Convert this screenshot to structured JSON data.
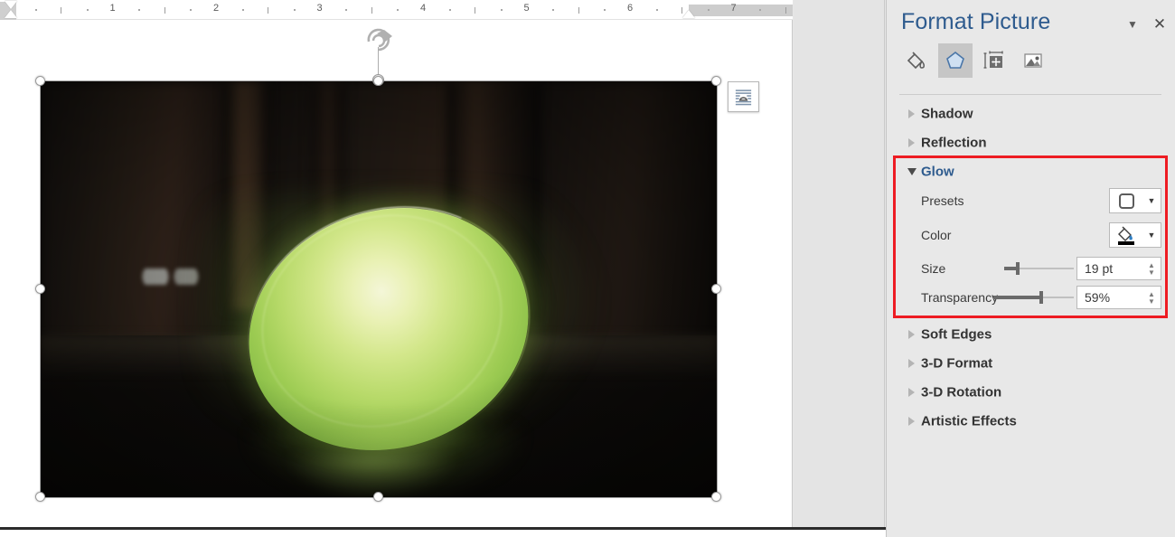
{
  "panel": {
    "title": "Format Picture",
    "caret_icon": "chevron-down-icon",
    "close_icon": "close-icon",
    "tabs": [
      {
        "name": "fill-line",
        "icon": "paint-bucket-icon"
      },
      {
        "name": "effects",
        "icon": "pentagon-icon",
        "active": true
      },
      {
        "name": "size-properties",
        "icon": "layout-measure-icon"
      },
      {
        "name": "picture",
        "icon": "image-icon"
      }
    ],
    "sections": [
      {
        "id": "shadow",
        "label": "Shadow",
        "expanded": false
      },
      {
        "id": "reflection",
        "label": "Reflection",
        "expanded": false
      },
      {
        "id": "glow",
        "label": "Glow",
        "expanded": true,
        "highlighted": true
      },
      {
        "id": "soft-edges",
        "label": "Soft Edges",
        "expanded": false
      },
      {
        "id": "3d-format",
        "label": "3-D Format",
        "expanded": false
      },
      {
        "id": "3d-rotation",
        "label": "3-D Rotation",
        "expanded": false
      },
      {
        "id": "artistic-effects",
        "label": "Artistic Effects",
        "expanded": false
      }
    ],
    "glow": {
      "presets": {
        "label_pre": "P",
        "label_accel": "r",
        "label_post": "esets",
        "label": "Presets",
        "icon": "rounded-square-outline-icon",
        "caret_icon": "chevron-down-icon"
      },
      "color": {
        "label": "Color",
        "icon": "paint-bucket-icon",
        "swatch_color": "#000000",
        "caret_icon": "chevron-down-icon"
      },
      "size": {
        "label": "Size",
        "value": "19 pt",
        "slider_percent": 19
      },
      "transparency": {
        "label": "Transparency",
        "value": "59%",
        "slider_percent": 59
      }
    },
    "accent_color": "#2e5b8e",
    "highlight_color": "#ee1c23"
  },
  "document": {
    "ruler": {
      "numbers": [
        "1",
        "2",
        "3",
        "4",
        "5",
        "6",
        "7"
      ],
      "left_indent_icon": "indent-markers-icon",
      "right_indent_icon": "right-indent-marker-icon"
    },
    "picture": {
      "alt": "glowing green dome lamp on dark floor",
      "selected": true,
      "rotate_handle_icon": "rotate-icon",
      "layout_options_icon": "layout-options-icon",
      "handles": [
        "top-left",
        "top-center",
        "top-right",
        "middle-left",
        "middle-right",
        "bottom-left",
        "bottom-center",
        "bottom-right"
      ]
    }
  }
}
